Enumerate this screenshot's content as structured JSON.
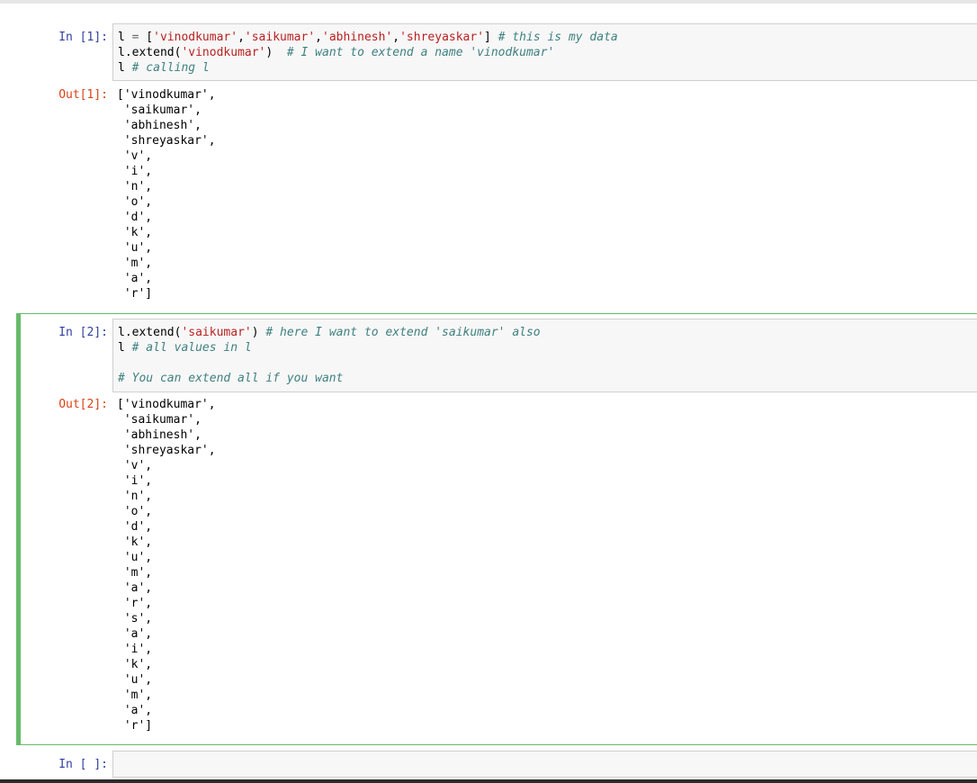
{
  "cells": [
    {
      "in_prompt": "In [1]:",
      "code": [
        [
          {
            "t": "l "
          },
          {
            "t": "=",
            "c": "op"
          },
          {
            "t": " ["
          },
          {
            "t": "'vinodkumar'",
            "c": "str"
          },
          {
            "t": ","
          },
          {
            "t": "'saikumar'",
            "c": "str"
          },
          {
            "t": ","
          },
          {
            "t": "'abhinesh'",
            "c": "str"
          },
          {
            "t": ","
          },
          {
            "t": "'shreyaskar'",
            "c": "str"
          },
          {
            "t": "] "
          },
          {
            "t": "# this is my data",
            "c": "cmt"
          }
        ],
        [
          {
            "t": "l.extend("
          },
          {
            "t": "'vinodkumar'",
            "c": "str"
          },
          {
            "t": ")  "
          },
          {
            "t": "# I want to extend a name 'vinodkumar'",
            "c": "cmt"
          }
        ],
        [
          {
            "t": "l "
          },
          {
            "t": "# calling l",
            "c": "cmt"
          }
        ]
      ],
      "out_prompt": "Out[1]:",
      "output": [
        "['vinodkumar',",
        " 'saikumar',",
        " 'abhinesh',",
        " 'shreyaskar',",
        " 'v',",
        " 'i',",
        " 'n',",
        " 'o',",
        " 'd',",
        " 'k',",
        " 'u',",
        " 'm',",
        " 'a',",
        " 'r']"
      ]
    },
    {
      "in_prompt": "In [2]:",
      "code": [
        [
          {
            "t": "l.extend("
          },
          {
            "t": "'saikumar'",
            "c": "str"
          },
          {
            "t": ") "
          },
          {
            "t": "# here I want to extend 'saikumar' also",
            "c": "cmt"
          }
        ],
        [
          {
            "t": "l "
          },
          {
            "t": "# all values in l",
            "c": "cmt"
          }
        ],
        [],
        [
          {
            "t": "# You can extend all if you want",
            "c": "cmt"
          }
        ]
      ],
      "out_prompt": "Out[2]:",
      "output": [
        "['vinodkumar',",
        " 'saikumar',",
        " 'abhinesh',",
        " 'shreyaskar',",
        " 'v',",
        " 'i',",
        " 'n',",
        " 'o',",
        " 'd',",
        " 'k',",
        " 'u',",
        " 'm',",
        " 'a',",
        " 'r',",
        " 's',",
        " 'a',",
        " 'i',",
        " 'k',",
        " 'u',",
        " 'm',",
        " 'a',",
        " 'r']"
      ]
    },
    {
      "in_prompt": "In [ ]:"
    }
  ],
  "colors": {
    "in_prompt": "#303f9f",
    "out_prompt": "#d84315",
    "selected_border": "#66bb6a",
    "string": "#ba2121",
    "comment": "#408080"
  }
}
